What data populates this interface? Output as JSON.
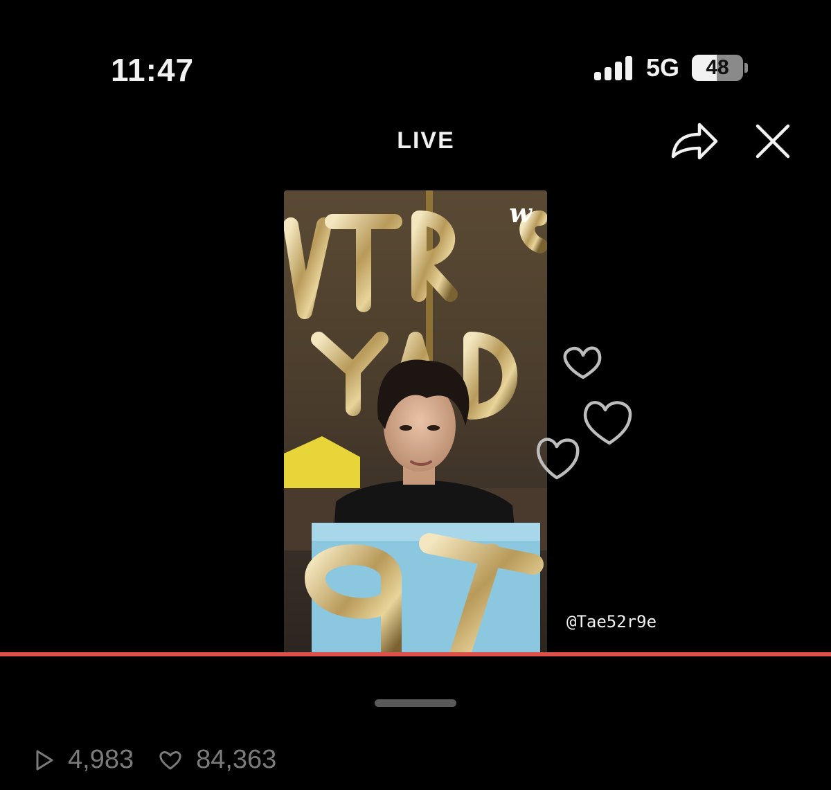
{
  "status_bar": {
    "time": "11:47",
    "network": "5G",
    "battery": "48",
    "battery_level": 0.48
  },
  "header": {
    "title": "LIVE",
    "share_icon": "share-icon",
    "close_icon": "close-icon"
  },
  "video": {
    "logo": "w",
    "watermark": "@Tae52r9e"
  },
  "reactions": {
    "icon": "heart-icon"
  },
  "stats": {
    "views": "4,983",
    "likes": "84,363"
  },
  "colors": {
    "progress": "#e0504a",
    "stat_text": "#7b7b7b",
    "background": "#000000"
  }
}
